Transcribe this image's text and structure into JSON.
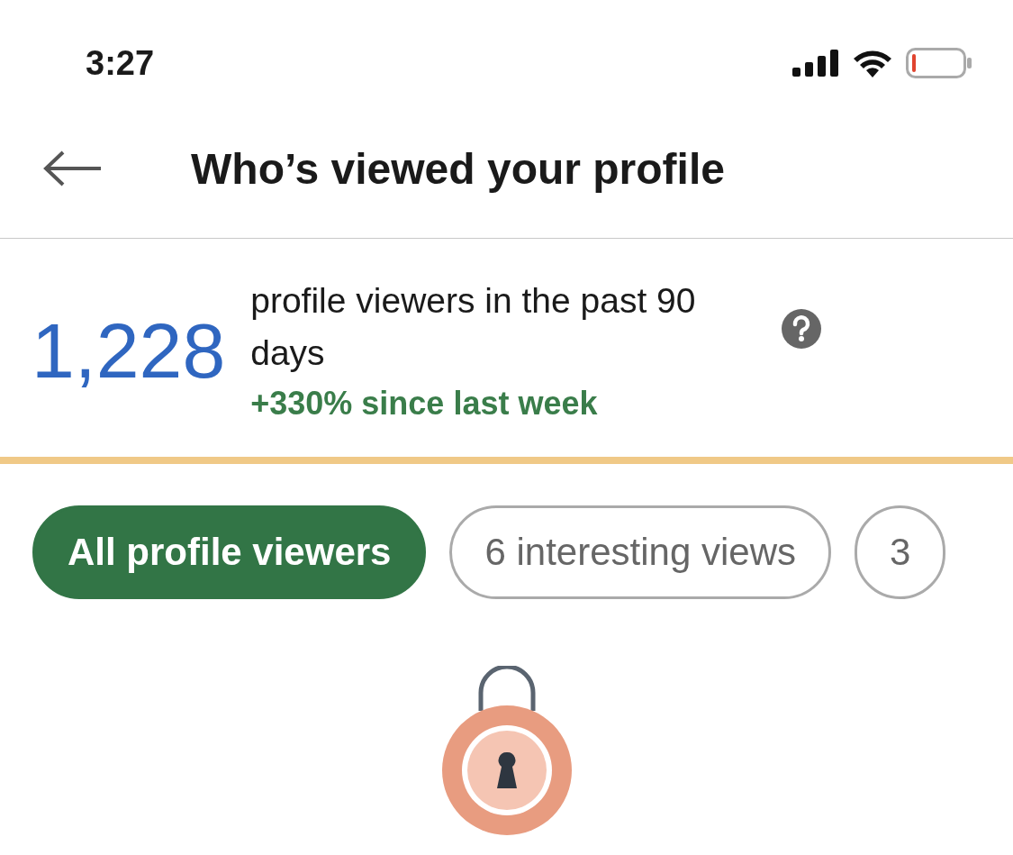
{
  "status_bar": {
    "time": "3:27"
  },
  "header": {
    "title": "Who’s viewed your profile"
  },
  "summary": {
    "count": "1,228",
    "description": "profile viewers in the past 90 days",
    "change": "+330% since last week"
  },
  "filters": [
    {
      "label": "All profile viewers",
      "selected": true
    },
    {
      "label": "6 interesting views",
      "selected": false
    },
    {
      "label": "3",
      "selected": false
    }
  ]
}
